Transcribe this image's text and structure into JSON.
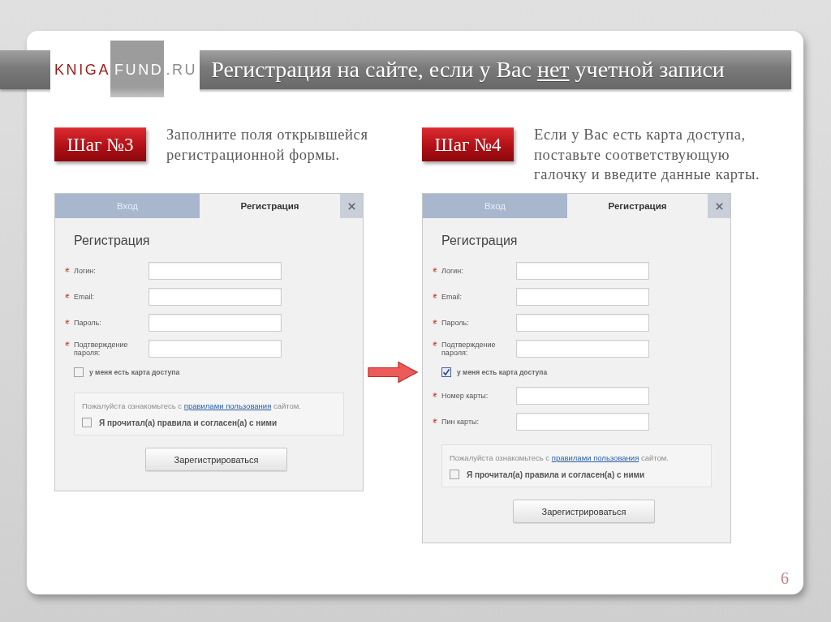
{
  "header": {
    "logo": [
      {
        "text": "KNIGA",
        "kind": "brand"
      },
      {
        "text": "FUND",
        "kind": "block"
      },
      {
        "text": ".RU",
        "kind": "suffix"
      }
    ],
    "title": [
      {
        "text": "Регистрация на сайте, если у Вас",
        "underlined": false
      },
      {
        "text": "нет",
        "underlined": true
      },
      {
        "text": "учетной записи",
        "underlined": false
      }
    ]
  },
  "steps": [
    {
      "badge": "Шаг №3",
      "instruction": [
        "Заполните поля открывшейся",
        "регистрационной формы."
      ],
      "form": {
        "tabs": [
          {
            "label": "Вход",
            "selected": false
          },
          {
            "label": "Регистрация",
            "selected": true
          }
        ],
        "heading": "Регистрация",
        "fields": [
          {
            "kind": "text",
            "label": "Логин:",
            "required": true
          },
          {
            "kind": "text",
            "label": "Email:",
            "required": true
          },
          {
            "kind": "text",
            "label": "Пароль:",
            "required": true
          },
          {
            "kind": "text",
            "label": "Подтверждение пароля:",
            "required": true
          },
          {
            "kind": "checkbox",
            "label": "у меня есть карта доступа",
            "checked": false,
            "pointer_arrow": false
          }
        ],
        "terms": {
          "text": "Пожалуйста ознакомьтесь с",
          "link": "правилами пользования",
          "text_after": "сайтом."
        },
        "agreement": {
          "label": "Я прочитал(а) правила и согласен(а) с ними",
          "checked": false
        },
        "submit": "Зарегистрироваться"
      }
    },
    {
      "badge": "Шаг №4",
      "instruction": [
        "Если у Вас есть карта доступа,",
        "поставьте соответствующую",
        "галочку и введите данные карты."
      ],
      "form": {
        "tabs": [
          {
            "label": "Вход",
            "selected": false
          },
          {
            "label": "Регистрация",
            "selected": true
          }
        ],
        "heading": "Регистрация",
        "fields": [
          {
            "kind": "text",
            "label": "Логин:",
            "required": true
          },
          {
            "kind": "text",
            "label": "Email:",
            "required": true
          },
          {
            "kind": "text",
            "label": "Пароль:",
            "required": true
          },
          {
            "kind": "text",
            "label": "Подтверждение пароля:",
            "required": true
          },
          {
            "kind": "checkbox",
            "label": "у меня есть карта доступа",
            "checked": true,
            "pointer_arrow": true
          },
          {
            "kind": "text",
            "label": "Номер карты:",
            "required": true
          },
          {
            "kind": "text",
            "label": "Пин карты:",
            "required": true
          }
        ],
        "terms": {
          "text": "Пожалуйста ознакомьтесь с",
          "link": "правилами пользования",
          "text_after": "сайтом."
        },
        "agreement": {
          "label": "Я прочитал(а) правила и согласен(а) с ними",
          "checked": false
        },
        "submit": "Зарегистрироваться"
      }
    }
  ],
  "page_number": "6"
}
